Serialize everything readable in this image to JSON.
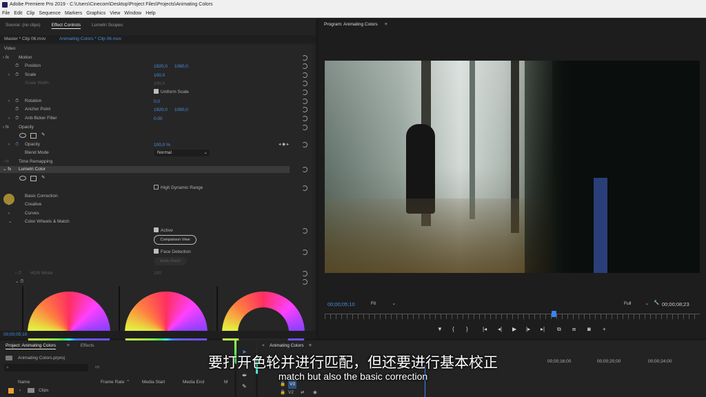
{
  "window": {
    "title": "Adobe Premiere Pro 2019 - C:\\Users\\Cinecom\\Desktop\\Project Files\\Projects\\Animating Colors"
  },
  "menu": [
    "File",
    "Edit",
    "Clip",
    "Sequence",
    "Markers",
    "Graphics",
    "View",
    "Window",
    "Help"
  ],
  "source_panel": {
    "tabs": [
      "Source: (no clips)",
      "Effect Controls",
      "Lumetri Scopes"
    ],
    "active_tab": "Effect Controls",
    "master_label": "Master * Clip 06.mov",
    "sequence_label": "Animating Colors * Clip 06.mov",
    "section_video": "Video",
    "fx_motion": "Motion",
    "position_label": "Position",
    "position_x": "1920,0",
    "position_y": "1080,0",
    "scale_label": "Scale",
    "scale_value": "100,0",
    "scale_width_label": "Scale Width",
    "scale_width_value": "100,0",
    "uniform_scale": "Uniform Scale",
    "rotation_label": "Rotation",
    "rotation_value": "0,0",
    "anchor_label": "Anchor Point",
    "anchor_x": "1920,0",
    "anchor_y": "1080,0",
    "antiflicker_label": "Anti-flicker Filter",
    "antiflicker_value": "0,00",
    "fx_opacity": "Opacity",
    "opacity_label": "Opacity",
    "opacity_value": "100,0 %",
    "blend_label": "Blend Mode",
    "blend_value": "Normal",
    "fx_time_remap": "Time Remapping",
    "fx_lumetri": "Lumetri Color",
    "hdr_range": "High Dynamic Range",
    "basic_correction": "Basic Correction",
    "creative": "Creative",
    "curves": "Curves",
    "wheels_match": "Color Wheels & Match",
    "active": "Active",
    "comparison_view": "Comparison View",
    "face_detection": "Face Detection",
    "apply_match": "Apply Match",
    "hdr_white_label": "HDR White",
    "hdr_white_value": "100",
    "timecode": "00;00;05;10"
  },
  "program_monitor": {
    "title": "Program: Animating Colors",
    "timecode": "00;00;05;10",
    "fit": "Fit",
    "quality": "Full",
    "duration": "00;00;08;23"
  },
  "project_panel": {
    "tabs": [
      "Project: Animating Colors",
      "Effects"
    ],
    "file": "Animating Colors.prproj",
    "columns": [
      "Name",
      "Frame Rate",
      "Media Start",
      "Media End",
      "M"
    ],
    "items": [
      "Clips"
    ]
  },
  "timeline_panel": {
    "title": "Animating Colors",
    "ruler": [
      "00;00;16;00",
      "00;00;20;00",
      "00;00;24;00"
    ],
    "tracks": [
      "V3",
      "V2"
    ]
  },
  "subtitles": {
    "cn": "要打开色轮并进行匹配，但还要进行基本校正",
    "en": "match but also the basic correction"
  },
  "colors": {
    "accent": "#4a90e2",
    "panel": "#232323",
    "bg": "#1a1a1a"
  }
}
